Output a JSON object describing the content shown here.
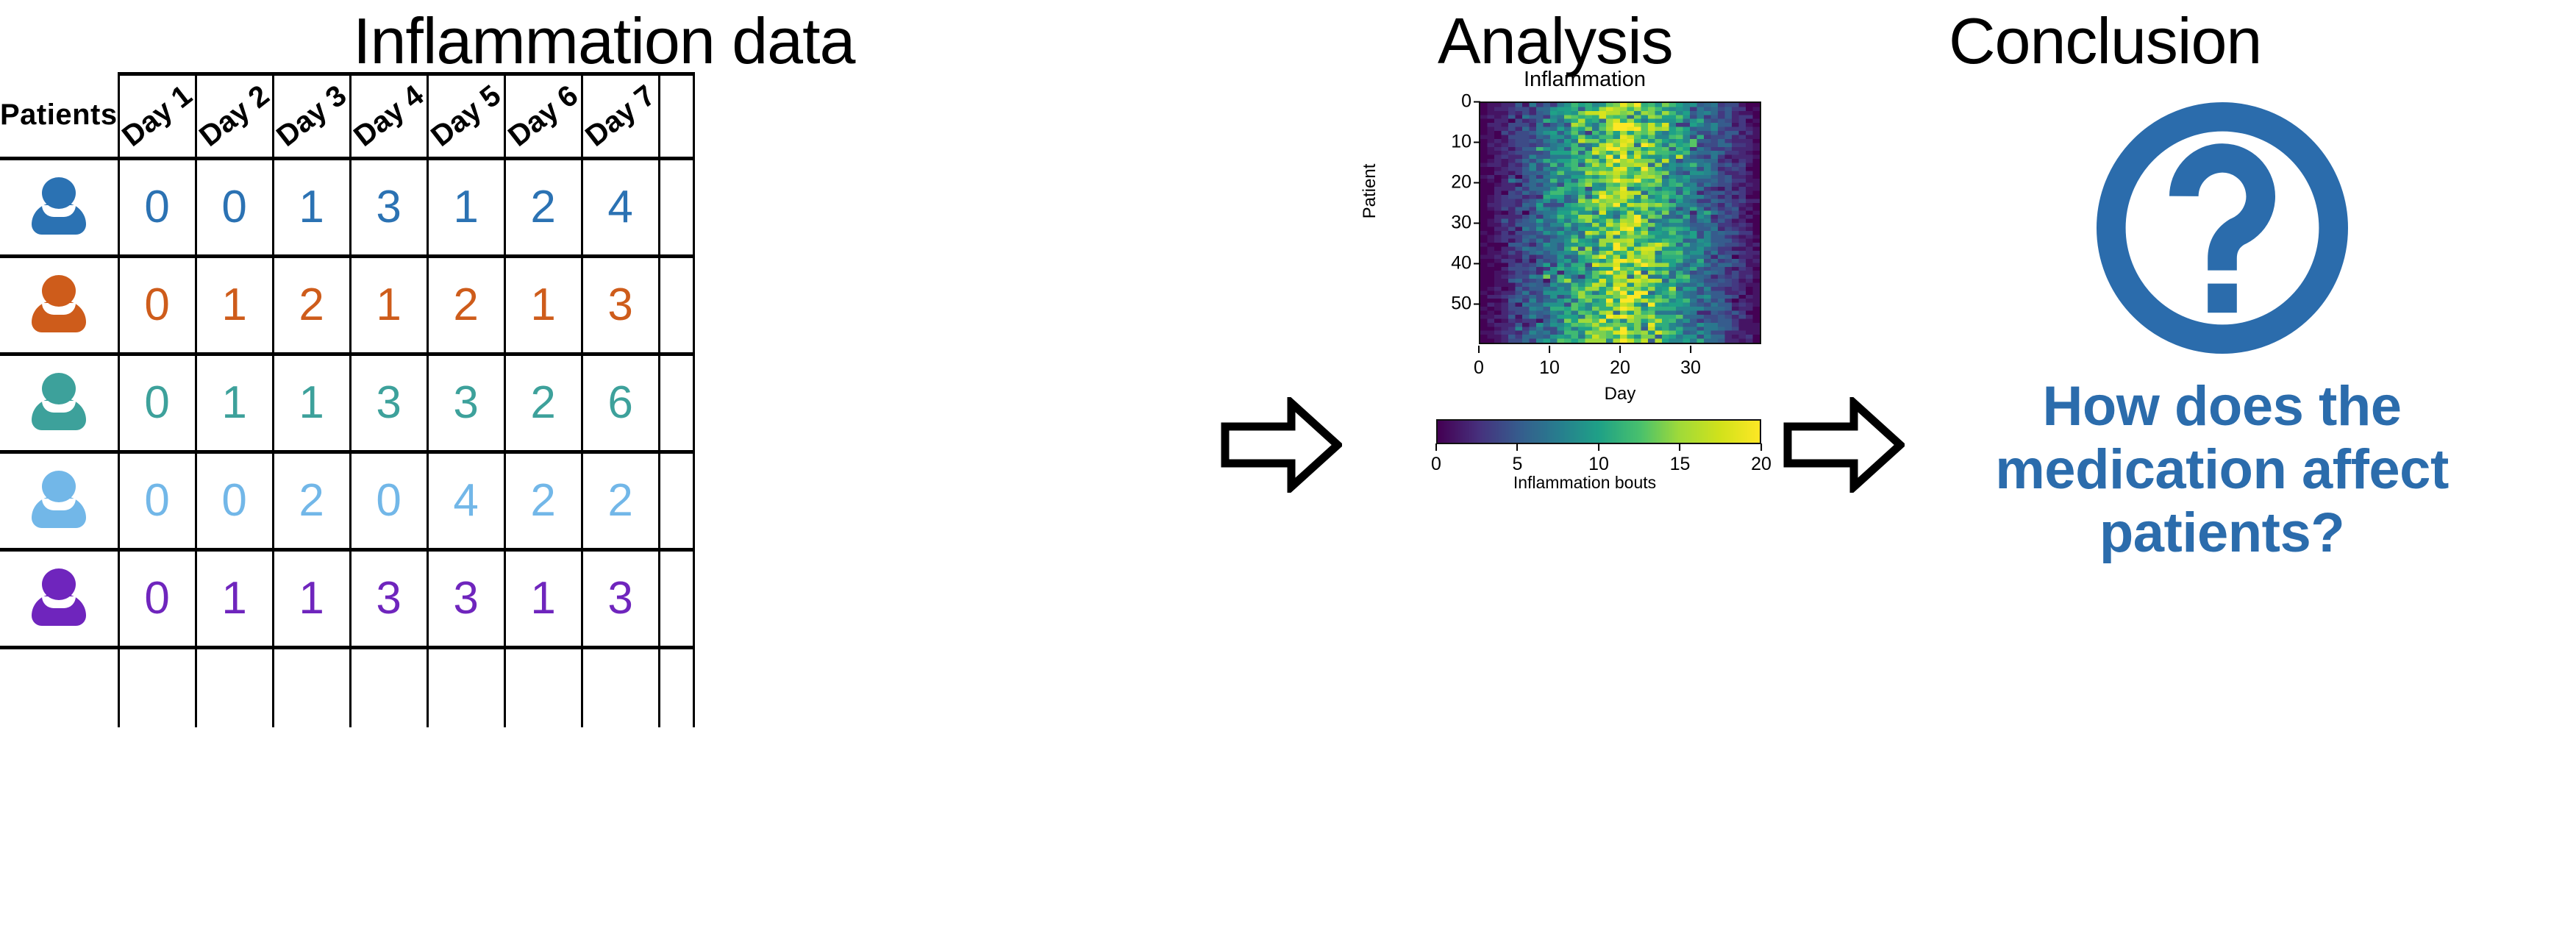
{
  "panels": {
    "data_title": "Inflammation data",
    "analysis_title": "Analysis",
    "conclusion_title": "Conclusion"
  },
  "table": {
    "patients_header": "Patients",
    "day_headers": [
      "Day 1",
      "Day 2",
      "Day 3",
      "Day 4",
      "Day 5",
      "Day 6",
      "Day 7"
    ],
    "rows": [
      {
        "icon": "person-icon",
        "color": "#2b72b3",
        "values": [
          "0",
          "0",
          "1",
          "3",
          "1",
          "2",
          "4"
        ]
      },
      {
        "icon": "person-icon",
        "color": "#ce5c1b",
        "values": [
          "0",
          "1",
          "2",
          "1",
          "2",
          "1",
          "3"
        ]
      },
      {
        "icon": "person-icon",
        "color": "#3da19b",
        "values": [
          "0",
          "1",
          "1",
          "3",
          "3",
          "2",
          "6"
        ]
      },
      {
        "icon": "person-icon",
        "color": "#72b7e8",
        "values": [
          "0",
          "0",
          "2",
          "0",
          "4",
          "2",
          "2"
        ]
      },
      {
        "icon": "person-icon",
        "color": "#6f25bd",
        "values": [
          "0",
          "1",
          "1",
          "3",
          "3",
          "1",
          "3"
        ]
      }
    ]
  },
  "arrows": {
    "first_label": "arrow-right",
    "second_label": "arrow-right"
  },
  "conclusion": {
    "question_icon": "question-mark-icon",
    "text": "How does the medication affect patients?",
    "accent_color": "#2b6cac"
  },
  "chart_data": {
    "type": "heatmap",
    "title": "Inflammation",
    "xlabel": "Day",
    "ylabel": "Patient",
    "xticks": [
      0,
      10,
      20,
      30
    ],
    "yticks": [
      0,
      10,
      20,
      30,
      40,
      50
    ],
    "xlim": [
      0,
      40
    ],
    "ylim": [
      0,
      60
    ],
    "n_days": 40,
    "n_patients": 60,
    "grid": false,
    "colormap": "viridis",
    "colorbar": {
      "label": "Inflammation bouts",
      "ticks": [
        0,
        5,
        10,
        15,
        20
      ],
      "vmin": 0,
      "vmax": 20,
      "position": "bottom",
      "orientation": "horizontal"
    },
    "pattern": "Inflammation bouts ramp up from 0 at day 0 to a peak around day 18-22 then decline back toward 0 by day 40; the same tent-shaped profile repeats for all 60 patients with per-cell noise.",
    "day_mean_profile": [
      0,
      0.6,
      1.3,
      2.0,
      2.8,
      3.5,
      4.2,
      5.0,
      5.7,
      6.4,
      7.2,
      8.0,
      8.8,
      9.6,
      10.4,
      11.3,
      12.2,
      13.2,
      14.1,
      15.0,
      15.6,
      15.0,
      14.1,
      13.2,
      12.2,
      11.3,
      10.4,
      9.6,
      8.8,
      8.0,
      7.2,
      6.4,
      5.7,
      5.0,
      4.2,
      3.5,
      2.8,
      2.0,
      1.3,
      0.6
    ],
    "colormap_stops": [
      {
        "t": 0.0,
        "hex": "#440154"
      },
      {
        "t": 0.13,
        "hex": "#46327e"
      },
      {
        "t": 0.25,
        "hex": "#365c8d"
      },
      {
        "t": 0.38,
        "hex": "#277f8e"
      },
      {
        "t": 0.5,
        "hex": "#1fa187"
      },
      {
        "t": 0.63,
        "hex": "#49c16d"
      },
      {
        "t": 0.75,
        "hex": "#9fda3a"
      },
      {
        "t": 0.88,
        "hex": "#d2e21b"
      },
      {
        "t": 1.0,
        "hex": "#fde725"
      }
    ]
  }
}
